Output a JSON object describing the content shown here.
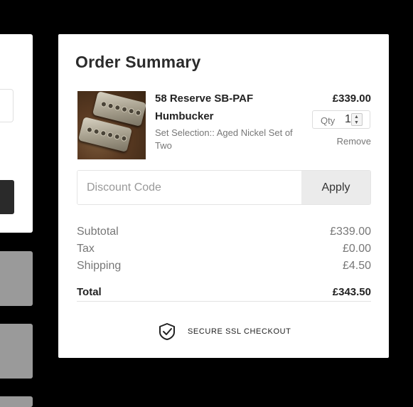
{
  "summary": {
    "title": "Order Summary",
    "item": {
      "name": "58 Reserve SB-PAF Humbucker",
      "variant": "Set Selection:: Aged Nickel Set of Two",
      "price": "£339.00",
      "qty_label": "Qty",
      "qty_value": "1",
      "remove_label": "Remove"
    },
    "discount": {
      "placeholder": "Discount Code",
      "apply_label": "Apply"
    },
    "totals": {
      "subtotal_label": "Subtotal",
      "subtotal_value": "£339.00",
      "tax_label": "Tax",
      "tax_value": "£0.00",
      "shipping_label": "Shipping",
      "shipping_value": "£4.50",
      "total_label": "Total",
      "total_value": "£343.50"
    },
    "secure_text": "SECURE SSL CHECKOUT",
    "secure_icon": "shield-check-icon"
  },
  "colors": {
    "background": "#000000",
    "card": "#ffffff",
    "apply_button": "#ebebeb",
    "muted_text": "#777777"
  }
}
